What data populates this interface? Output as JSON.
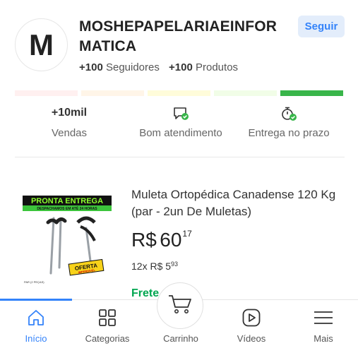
{
  "seller": {
    "avatar_letter": "M",
    "name": "MOSHEPAPELARIAEINFORMATICA",
    "follow_label": "Seguir",
    "followers_count": "+100",
    "followers_label": "Seguidores",
    "products_count": "+100",
    "products_label": "Produtos"
  },
  "reputation": {
    "thermometer_colors": [
      "#fff0f0",
      "#fff5e8",
      "#fffcda",
      "#f1fde7",
      "#39b54a"
    ]
  },
  "metrics": [
    {
      "value": "+10mil",
      "label": "Vendas"
    },
    {
      "icon": "chat-check-icon",
      "label": "Bom atendimento"
    },
    {
      "icon": "stopwatch-check-icon",
      "label": "Entrega no prazo"
    }
  ],
  "product": {
    "title": "Muleta Ortopédica Canadense 120 Kg (par - 2un De Muletas)",
    "currency": "R$",
    "price_int": "60",
    "price_cents": "17",
    "installments_prefix": "12x R$ 5",
    "installments_cents": "93",
    "shipping": "Frete",
    "image": {
      "banner": "PRONTA ENTREGA",
      "subbanner": "DESPACHAMOS EM ATÉ 24 HORAS",
      "badge_line1": "OFERTA",
      "badge_line2": "IMPERDÍVEL",
      "caption": "PAR (2 PEÇAS)"
    }
  },
  "nav": {
    "items": [
      {
        "label": "Início",
        "icon": "home-icon"
      },
      {
        "label": "Categorias",
        "icon": "grid-icon"
      },
      {
        "label": "Carrinho",
        "icon": "cart-icon"
      },
      {
        "label": "Vídeos",
        "icon": "play-icon"
      },
      {
        "label": "Mais",
        "icon": "menu-icon"
      }
    ]
  },
  "colors": {
    "accent": "#3483fa",
    "shipping_green": "#00a650",
    "check_green": "#39b54a"
  }
}
